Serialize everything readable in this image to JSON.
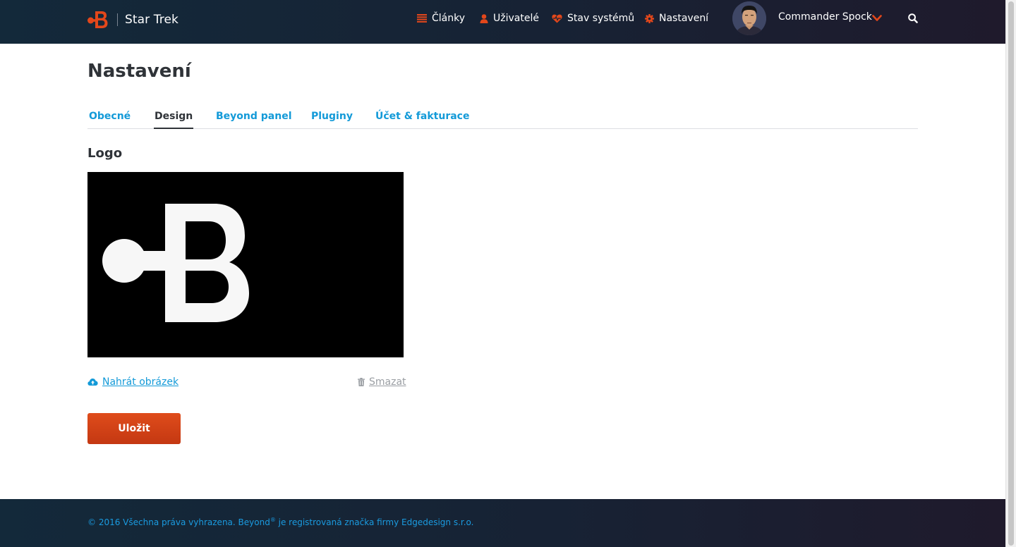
{
  "header": {
    "site_title": "Star Trek",
    "nav": [
      {
        "label": "Články",
        "icon": "list-icon"
      },
      {
        "label": "Uživatelé",
        "icon": "user-icon"
      },
      {
        "label": "Stav systémů",
        "icon": "heartbeat-icon"
      },
      {
        "label": "Nastavení",
        "icon": "gear-icon"
      }
    ],
    "user_name": "Commander Spock"
  },
  "page": {
    "title": "Nastavení",
    "tabs": [
      {
        "label": "Obecné",
        "active": false
      },
      {
        "label": "Design",
        "active": true
      },
      {
        "label": "Beyond panel",
        "active": false
      },
      {
        "label": "Pluginy",
        "active": false
      },
      {
        "label": "Účet & fakturace",
        "active": false
      }
    ],
    "logo_section": {
      "title": "Logo",
      "upload_label": "Nahrát obrázek",
      "delete_label": "Smazat"
    },
    "save_label": "Uložit"
  },
  "footer": {
    "text_before": "© 2016 Všechna práva vyhrazena. Beyond",
    "trademark": "®",
    "text_after": " je registrovaná značka firmy Edgedesign s.r.o."
  },
  "colors": {
    "accent": "#139ad8",
    "brand_orange": "#e2471b",
    "header_bg": "#152637",
    "text_dark": "#2f3338"
  }
}
